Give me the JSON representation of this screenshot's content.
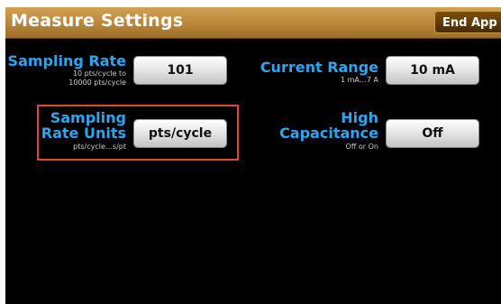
{
  "title_bar": {
    "title": "Measure Settings",
    "end_app_label": "End App"
  },
  "settings": {
    "sampling_rate": {
      "label": "Sampling Rate",
      "hint_line1": "10 pts/cycle to",
      "hint_line2": "10000 pts/cycle",
      "value": "101"
    },
    "current_range": {
      "label": "Current Range",
      "hint": "1 mA…7 A",
      "value": "10 mA"
    },
    "sampling_rate_units": {
      "label_line1": "Sampling",
      "label_line2": "Rate Units",
      "hint": "pts/cycle…s/pt",
      "value": "pts/cycle"
    },
    "high_capacitance": {
      "label_line1": "High",
      "label_line2": "Capacitance",
      "hint": "Off or On",
      "value": "Off"
    }
  },
  "colors": {
    "label_blue": "#29a6f2",
    "title_bar_gold": "#b88639",
    "highlight_red": "#e0453a"
  }
}
